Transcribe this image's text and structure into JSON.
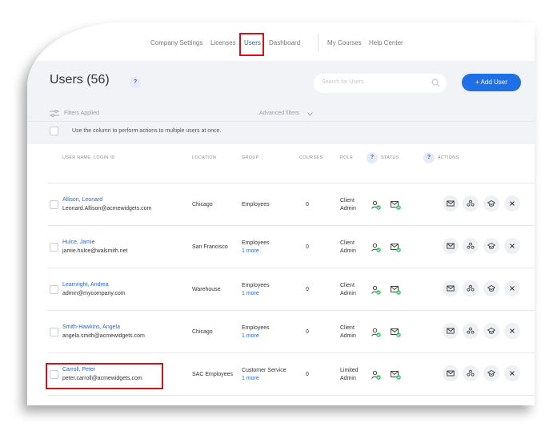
{
  "nav": {
    "company_settings": "Company Settings",
    "licenses": "Licenses",
    "users": "Users",
    "dashboard": "Dashboard",
    "my_courses": "My Courses",
    "help_center": "Help Center"
  },
  "page": {
    "title": "Users (56)",
    "help": "?",
    "search_placeholder": "Search for Users",
    "add_user": "+ Add User",
    "filters_applied": "Filters Applied",
    "advanced_filters": "Advanced filters",
    "bulk_hint": "Use the column to perform actions to multiple users at once."
  },
  "columns": {
    "user": "USER NAME, LOGIN ID",
    "location": "LOCATION",
    "group": "GROUP",
    "courses": "COURSES",
    "role": "ROLE",
    "status": "STATUS",
    "actions": "ACTIONS"
  },
  "rows": [
    {
      "name": "Allison, Leonard",
      "login": "Leonard.Allison@acmewidgets.com",
      "location": "Chicago",
      "group": "Employees",
      "more": "",
      "courses": "0",
      "role1": "Client",
      "role2": "Admin"
    },
    {
      "name": "Hulce, Jamie",
      "login": "jamie.hulce@walsmith.net",
      "location": "San Francisco",
      "group": "Employees",
      "more": "1 more",
      "courses": "0",
      "role1": "Client",
      "role2": "Admin"
    },
    {
      "name": "Learnright, Andrea",
      "login": "admin@mycompany.com",
      "location": "Warehouse",
      "group": "Employees",
      "more": "1 more",
      "courses": "0",
      "role1": "Client",
      "role2": "Admin"
    },
    {
      "name": "Smith-Hawkins, Angela",
      "login": "angela.smith@acmewidgets.com",
      "location": "Chicago",
      "group": "Employees",
      "more": "1 more",
      "courses": "0",
      "role1": "Client",
      "role2": "Admin"
    },
    {
      "name": "Carroll, Peter",
      "login": "peter.carroll@acmewidgets.com",
      "location": "SAC Employees",
      "group": "Customer Service",
      "more": "1 more",
      "courses": "0",
      "role1": "Limited",
      "role2": "Admin"
    }
  ],
  "icons": {
    "status": [
      "user-check-icon",
      "mail-check-icon"
    ],
    "actions": [
      "envelope-icon",
      "group-icon",
      "graduation-cap-icon",
      "close-icon"
    ]
  },
  "colors": {
    "accent": "#1f6fe5",
    "link": "#2a66c9",
    "highlight": "#d0121a",
    "status_ok": "#3cc46a"
  }
}
